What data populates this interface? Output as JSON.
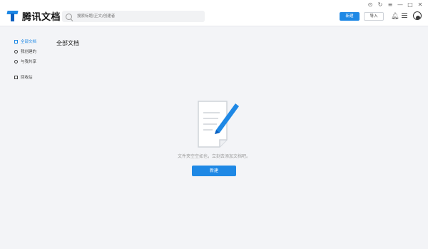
{
  "app": {
    "title": "腾讯文档"
  },
  "search": {
    "placeholder": "搜索标题/正文/创建者"
  },
  "toolbar": {
    "new_label": "新建",
    "import_label": "导入"
  },
  "window_controls": [
    "⊙",
    "↻",
    "≡",
    "—",
    "□",
    "✕"
  ],
  "sidebar": {
    "items": [
      {
        "label": "全部文档"
      },
      {
        "label": "我创建的"
      },
      {
        "label": "与我共享"
      },
      {
        "label": "回收站"
      }
    ]
  },
  "main": {
    "title": "全部文档",
    "empty_message": "文件夹空空如也，立刻去添加文档吧。",
    "new_button_label": "新建"
  },
  "colors": {
    "accent": "#1e88e5",
    "background": "#f3f4f7"
  }
}
